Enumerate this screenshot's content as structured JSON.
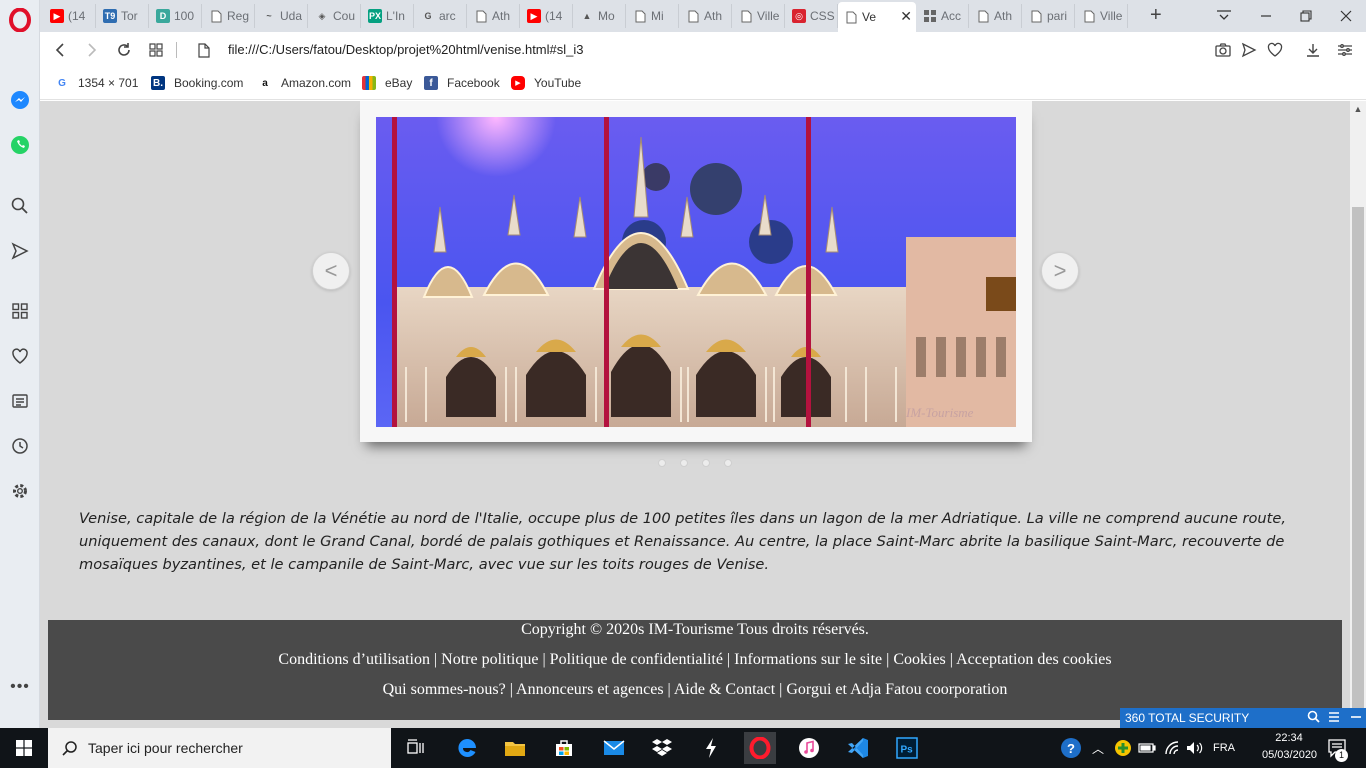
{
  "tabs": [
    {
      "label": "(14",
      "icon": "youtube-icon"
    },
    {
      "label": "Tor",
      "icon": "torrent-icon"
    },
    {
      "label": "100",
      "icon": "d-site-icon"
    },
    {
      "label": "Reg",
      "icon": "page-icon"
    },
    {
      "label": "Uda",
      "icon": "udacity-icon"
    },
    {
      "label": "Cou",
      "icon": "codepen-icon"
    },
    {
      "label": "L'In",
      "icon": "pexels-icon"
    },
    {
      "label": "arc",
      "icon": "google-icon"
    },
    {
      "label": "Ath",
      "icon": "page-icon"
    },
    {
      "label": "(14",
      "icon": "youtube-icon"
    },
    {
      "label": "Mo",
      "icon": "google-drive-icon"
    },
    {
      "label": "Mi",
      "icon": "page-icon"
    },
    {
      "label": "Ath",
      "icon": "page-icon"
    },
    {
      "label": "Ville",
      "icon": "page-icon"
    },
    {
      "label": "CSS",
      "icon": "css-icon"
    },
    {
      "label": "Ve",
      "icon": "page-icon",
      "active": true
    },
    {
      "label": "Acc",
      "icon": "grid-icon"
    },
    {
      "label": "Ath",
      "icon": "page-icon"
    },
    {
      "label": "pari",
      "icon": "page-icon"
    },
    {
      "label": "Ville",
      "icon": "page-icon"
    }
  ],
  "address": {
    "url": "file:///C:/Users/fatou/Desktop/projet%20html/venise.html#sl_i3"
  },
  "bookmarks": [
    {
      "label": "1354 × 701",
      "icon": "google-icon"
    },
    {
      "label": "Booking.com",
      "icon": "booking-icon"
    },
    {
      "label": "Amazon.com",
      "icon": "amazon-icon"
    },
    {
      "label": "eBay",
      "icon": "ebay-icon"
    },
    {
      "label": "Facebook",
      "icon": "facebook-icon"
    },
    {
      "label": "YouTube",
      "icon": "youtube-icon"
    }
  ],
  "slider": {
    "prev_label": "<",
    "next_label": ">",
    "dots": 4,
    "watermark": "IM-Tourisme"
  },
  "content": {
    "description": "Venise, capitale de la région de la Vénétie au nord de l'Italie, occupe plus de 100 petites îles dans un lagon de la mer Adriatique. La ville ne comprend aucune route, uniquement des canaux, dont le Grand Canal, bordé de palais gothiques et Renaissance. Au centre, la place Saint-Marc abrite la basilique Saint-Marc, recouverte de mosaïques byzantines, et le campanile de Saint-Marc, avec vue sur les toits rouges de Venise."
  },
  "footer": {
    "copyright": "Copyright © 2020s IM-Tourisme Tous droits réservés.",
    "line2": "Conditions d’utilisation | Notre politique | Politique de confidentialité | Informations sur le site | Cookies | Acceptation des cookies",
    "line3": "Qui sommes-nous? | Annonceurs et agences | Aide & Contact | Gorgui et Adja Fatou coorporation"
  },
  "security_widget": {
    "label": "360 TOTAL SECURITY"
  },
  "taskbar": {
    "search_placeholder": "Taper ici pour rechercher",
    "language": "FRA",
    "time": "22:34",
    "date": "05/03/2020",
    "notifications": "1"
  },
  "colors": {
    "page_bg": "#d9d9d9",
    "footer_bg": "#4a4a4a",
    "sky": "#4a55f0",
    "security_blue": "#1e6fc9",
    "opera_red": "#e0102a"
  }
}
